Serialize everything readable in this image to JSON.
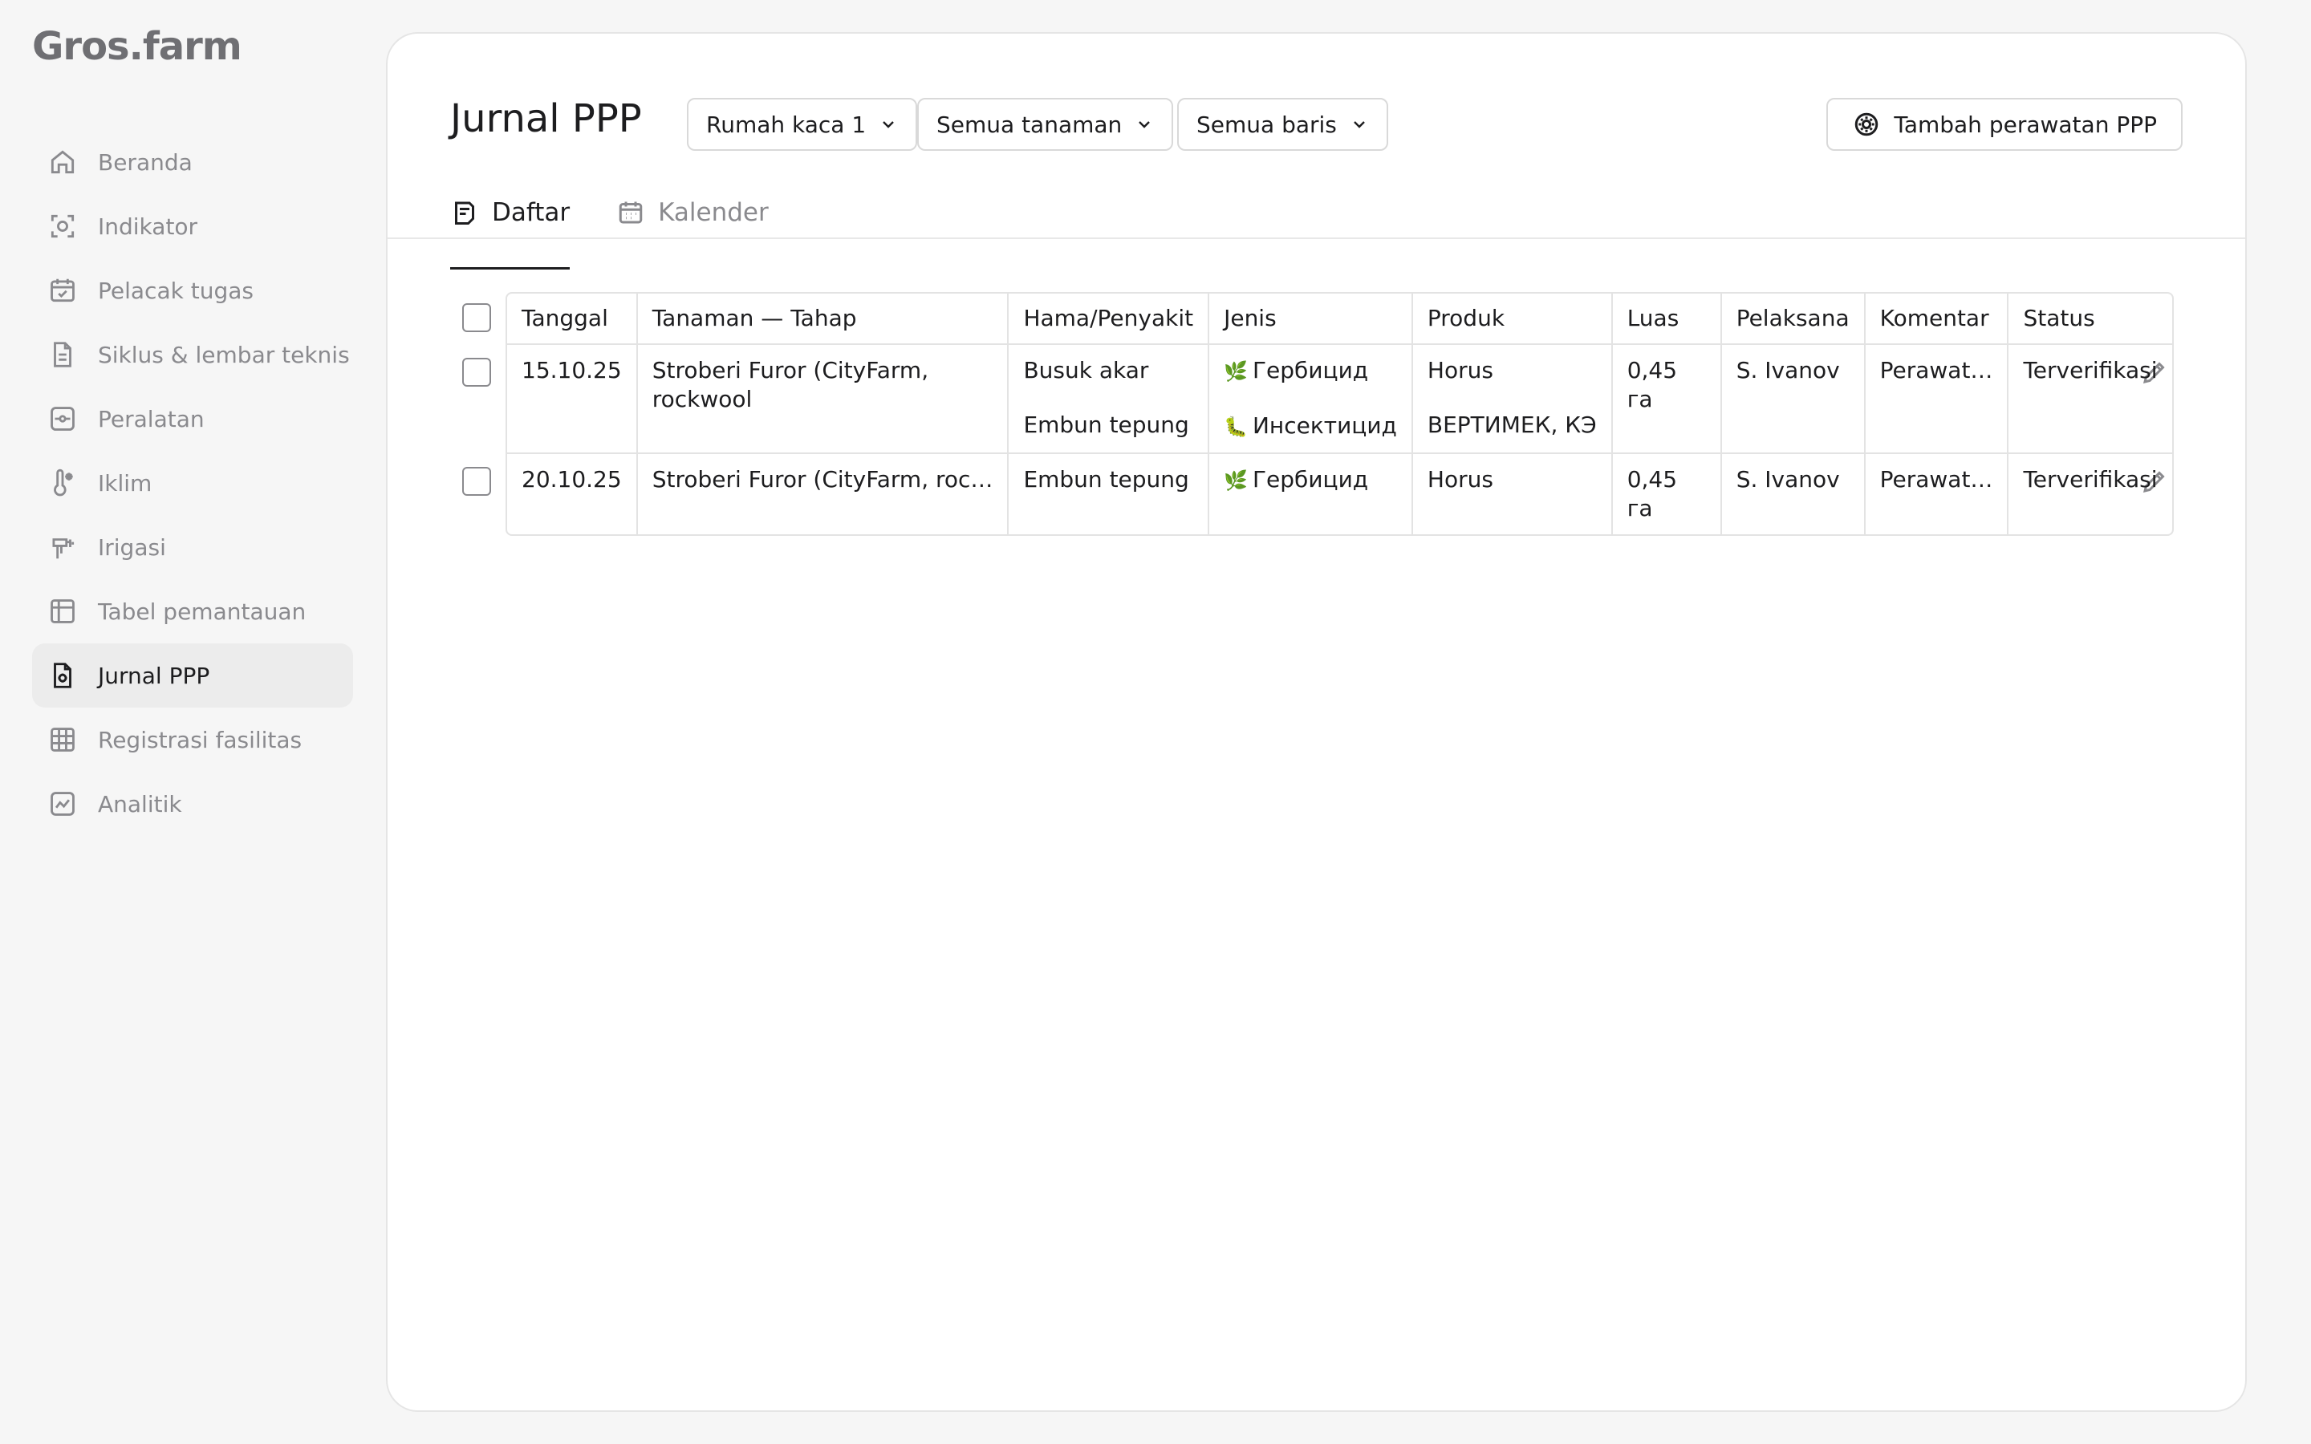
{
  "app": {
    "logo": "Gros.farm"
  },
  "sidebar": {
    "items": [
      {
        "label": "Beranda",
        "icon": "home-icon"
      },
      {
        "label": "Indikator",
        "icon": "sensor-icon"
      },
      {
        "label": "Pelacak tugas",
        "icon": "calendar-check-icon"
      },
      {
        "label": "Siklus & lembar teknis",
        "icon": "document-icon"
      },
      {
        "label": "Peralatan",
        "icon": "equipment-icon"
      },
      {
        "label": "Iklim",
        "icon": "thermometer-icon"
      },
      {
        "label": "Irigasi",
        "icon": "irrigation-icon"
      },
      {
        "label": "Tabel pemantauan",
        "icon": "table-icon"
      },
      {
        "label": "Jurnal PPP",
        "icon": "ppp-journal-icon",
        "active": true
      },
      {
        "label": "Registrasi fasilitas",
        "icon": "grid-icon"
      },
      {
        "label": "Analitik",
        "icon": "chart-icon"
      }
    ]
  },
  "header": {
    "title": "Jurnal PPP",
    "filters": {
      "greenhouse": "Rumah kaca 1",
      "plants": "Semua tanaman",
      "rows": "Semua baris"
    },
    "add_button": "Tambah perawatan PPP"
  },
  "tabs": {
    "list": "Daftar",
    "calendar": "Kalender"
  },
  "table": {
    "columns": {
      "date": "Tanggal",
      "plant_stage": "Tanaman — Tahap",
      "pest": "Hama/Penyakit",
      "type": "Jenis",
      "product": "Produk",
      "area": "Luas",
      "executor": "Pelaksana",
      "comment": "Komentar",
      "status": "Status"
    },
    "rows": [
      {
        "date": "15.10.25",
        "plant_stage": "Stroberi Furor (CityFarm, rockwool",
        "pest_1": "Busuk akar",
        "pest_2": "Embun tepung",
        "type_1": "Гербицид",
        "type_1_emoji": "🌿",
        "type_2": "Инсектицид",
        "type_2_emoji": "🐛",
        "product_1": "Horus",
        "product_2": "ВЕРТИМЕК, КЭ",
        "area": "0,45 га",
        "executor": "S. Ivanov",
        "comment": "Perawat…",
        "status": "Terverifikasi"
      },
      {
        "date": "20.10.25",
        "plant_stage": "Stroberi Furor (CityFarm, roc…",
        "pest_1": "Embun tepung",
        "type_1": "Гербицид",
        "type_1_emoji": "🌿",
        "product_1": "Horus",
        "area": "0,45 га",
        "executor": "S. Ivanov",
        "comment": "Perawat…",
        "status": "Terverifikasi"
      }
    ]
  }
}
